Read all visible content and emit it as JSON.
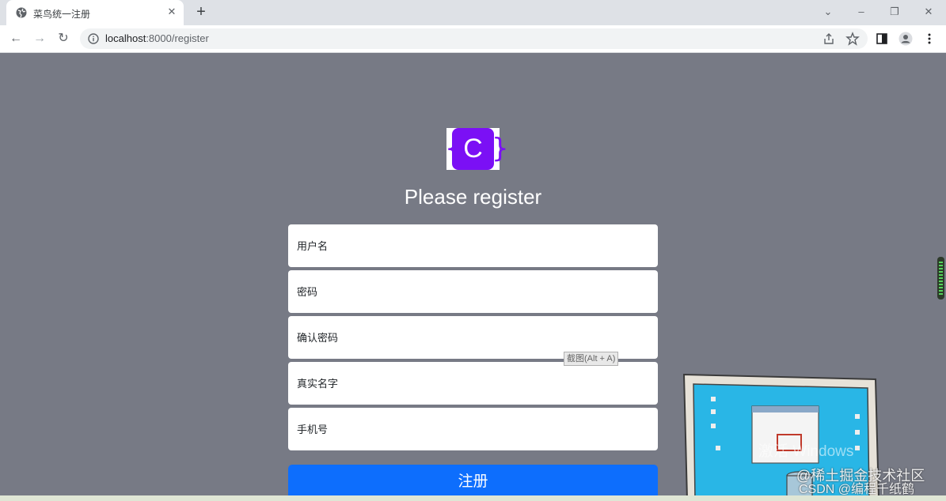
{
  "browser": {
    "tab": {
      "title": "菜鸟统一注册",
      "close_icon": "close-icon"
    },
    "new_tab_icon": "plus-icon",
    "address": {
      "host": "localhost",
      "path": ":8000/register"
    }
  },
  "page": {
    "logo_letter": "C",
    "heading": "Please register",
    "fields": {
      "username": "用户名",
      "password": "密码",
      "confirm_password": "确认密码",
      "real_name": "真实名字",
      "phone": "手机号"
    },
    "submit_label": "注册",
    "screenshot_tooltip": "截图(Alt + A)"
  },
  "overlay": {
    "activate_text": "激活 Windows",
    "watermark_community": "@稀土掘金技术社区",
    "watermark_csdn": "CSDN @编程千纸鹤"
  },
  "colors": {
    "page_bg": "#777a85",
    "logo": "#7b10f5",
    "primary_button": "#0d6efd"
  }
}
